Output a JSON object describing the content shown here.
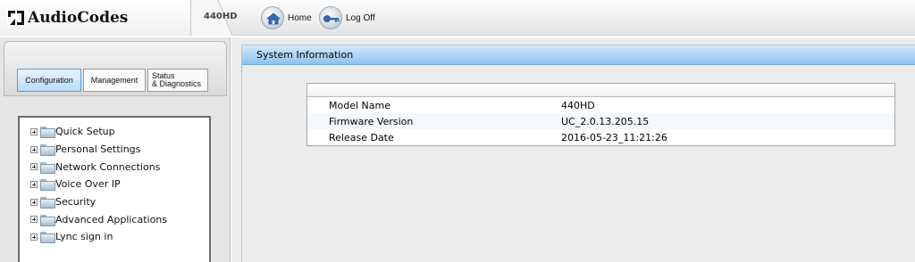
{
  "header": {
    "brand": "AudioCodes",
    "model": "440HD",
    "nav": [
      {
        "label": "Home",
        "icon": "home-icon"
      },
      {
        "label": "Log Off",
        "icon": "key-icon"
      }
    ]
  },
  "tabs": {
    "configuration": "Configuration",
    "management": "Management",
    "status_line1": "Status",
    "status_line2": "& Diagnostics",
    "active": "Configuration"
  },
  "tree": {
    "items": [
      {
        "label": "Quick Setup"
      },
      {
        "label": "Personal Settings"
      },
      {
        "label": "Network Connections"
      },
      {
        "label": "Voice Over IP"
      },
      {
        "label": "Security"
      },
      {
        "label": "Advanced Applications"
      },
      {
        "label": "Lync sign in"
      }
    ]
  },
  "panel": {
    "title": "System Information",
    "rows": [
      {
        "key": "Model Name",
        "value": "440HD"
      },
      {
        "key": "Firmware Version",
        "value": "UC_2.0.13.205.15"
      },
      {
        "key": "Release Date",
        "value": "2016-05-23_11:21:26"
      }
    ]
  },
  "colors": {
    "accent": "#8cc2ee",
    "tab_active": "#b8dcfa"
  }
}
